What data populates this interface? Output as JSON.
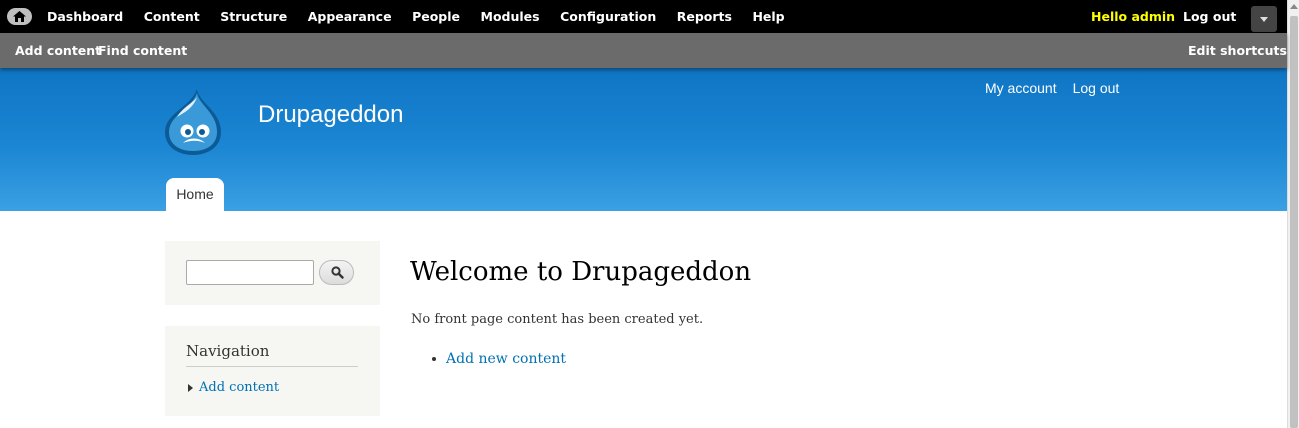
{
  "toolbar": {
    "menu": [
      "Dashboard",
      "Content",
      "Structure",
      "Appearance",
      "People",
      "Modules",
      "Configuration",
      "Reports",
      "Help"
    ],
    "hello_prefix": "Hello ",
    "username": "admin",
    "logout": "Log out",
    "icons": {
      "home": "home-icon",
      "toggle": "chevron-down-icon"
    }
  },
  "shortcuts": {
    "add_content": "Add content",
    "find_content": "Find content",
    "edit_shortcuts": "Edit shortcuts"
  },
  "header": {
    "site_name": "Drupageddon",
    "secondary_menu": [
      "My account",
      "Log out"
    ],
    "tab_home": "Home",
    "colors": {
      "gradient_top": "#0f75c4",
      "gradient_bottom": "#3ba0e4"
    }
  },
  "sidebar": {
    "search_value": "",
    "navigation_title": "Navigation",
    "navigation_items": [
      "Add content"
    ]
  },
  "main": {
    "title": "Welcome to Drupageddon",
    "intro": "No front page content has been created yet.",
    "links": [
      "Add new content"
    ]
  }
}
